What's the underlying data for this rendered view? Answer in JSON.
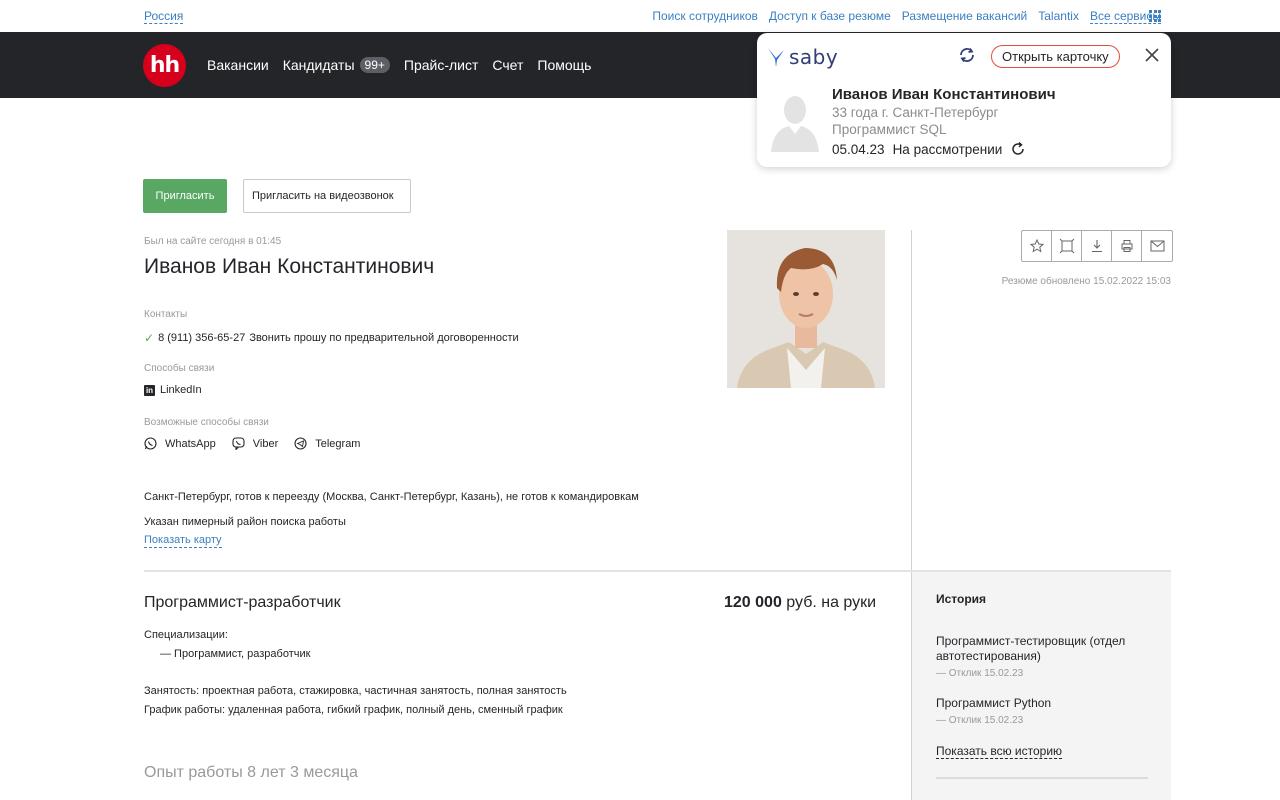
{
  "topbar": {
    "region": "Россия",
    "links": [
      "Поиск сотрудников",
      "Доступ к базе резюме",
      "Размещение вакансий",
      "Talantix"
    ],
    "all_services": "Все сервисы"
  },
  "navbar": {
    "logo": "hh",
    "items": [
      "Вакансии",
      "Кандидаты",
      "Прайс-лист",
      "Счет",
      "Помощь"
    ],
    "candidates_badge": "99+"
  },
  "saby_popup": {
    "brand": "saby",
    "open_card_label": "Открыть карточку",
    "name": "Иванов Иван Константинович",
    "age_city": "33 года  г. Санкт-Петербург",
    "position": "Программист SQL",
    "date": "05.04.23",
    "status": "На рассмотрении"
  },
  "actions": {
    "invite": "Пригласить",
    "invite_video": "Пригласить на видеозвонок"
  },
  "resume": {
    "last_seen": "Был на сайте сегодня в 01:45",
    "full_name": "Иванов Иван Константинович",
    "contacts_label": "Контакты",
    "phone": "8 (911) 356-65-27",
    "phone_note": "Звонить прошу по предварительной договоренности",
    "channels_label": "Способы связи",
    "linkedin": "LinkedIn",
    "possible_label": "Возможные способы связи",
    "messengers": [
      "WhatsApp",
      "Viber",
      "Telegram"
    ],
    "location": "Санкт-Петербург, готов к переезду (Москва, Санкт-Петербург, Казань), не готов к командировкам",
    "area_note": "Указан пимерный район поиска работы",
    "show_map": "Показать карту",
    "updated": "Резюме обновлено 15.02.2022 15:03"
  },
  "position": {
    "title": "Программист-разработчик",
    "salary_amount": "120 000",
    "salary_suffix": "руб. на руки",
    "specs_label": "Специализации:",
    "spec_item": "— Программист, разработчик",
    "employment": "Занятость: проектная работа, стажировка, частичная занятость, полная занятость",
    "schedule": "График работы: удаленная работа, гибкий график, полный день, сменный график",
    "experience": "Опыт работы 8 лет 3 месяца"
  },
  "history": {
    "title": "История",
    "items": [
      {
        "title": "Программист-тестировщик (отдел автотестирования)",
        "sub": "— Отклик 15.02.23"
      },
      {
        "title": "Программист Python",
        "sub": "— Отклик 15.02.23"
      }
    ],
    "show_all": "Показать всю историю"
  },
  "colors": {
    "brand_red": "#d6001c",
    "link_blue": "#3c7fc0",
    "invite_green": "#58a863",
    "nav_bg": "#232529"
  }
}
